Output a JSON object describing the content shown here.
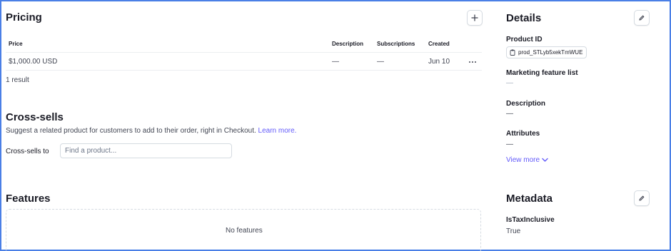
{
  "pricing": {
    "title": "Pricing",
    "columns": [
      "Price",
      "Description",
      "Subscriptions",
      "Created"
    ],
    "rows": [
      {
        "price": "$1,000.00 USD",
        "description": "—",
        "subscriptions": "—",
        "created": "Jun 10"
      }
    ],
    "result_count": "1 result"
  },
  "cross_sells": {
    "title": "Cross-sells",
    "description": "Suggest a related product for customers to add to their order, right in Checkout.",
    "learn_more": "Learn more.",
    "field_label": "Cross-sells to",
    "placeholder": "Find a product..."
  },
  "features": {
    "title": "Features",
    "empty_text": "No features"
  },
  "details": {
    "title": "Details",
    "product_id_label": "Product ID",
    "product_id": "prod_STLyb5xekTmWUE",
    "marketing_label": "Marketing feature list",
    "marketing_value": "—",
    "description_label": "Description",
    "description_value": "—",
    "attributes_label": "Attributes",
    "attributes_value": "—",
    "view_more": "View more"
  },
  "metadata": {
    "title": "Metadata",
    "key": "IsTaxInclusive",
    "value": "True"
  },
  "colors": {
    "link": "#625afa",
    "border": "#d5dbe1",
    "frame": "#4a7fe6"
  }
}
